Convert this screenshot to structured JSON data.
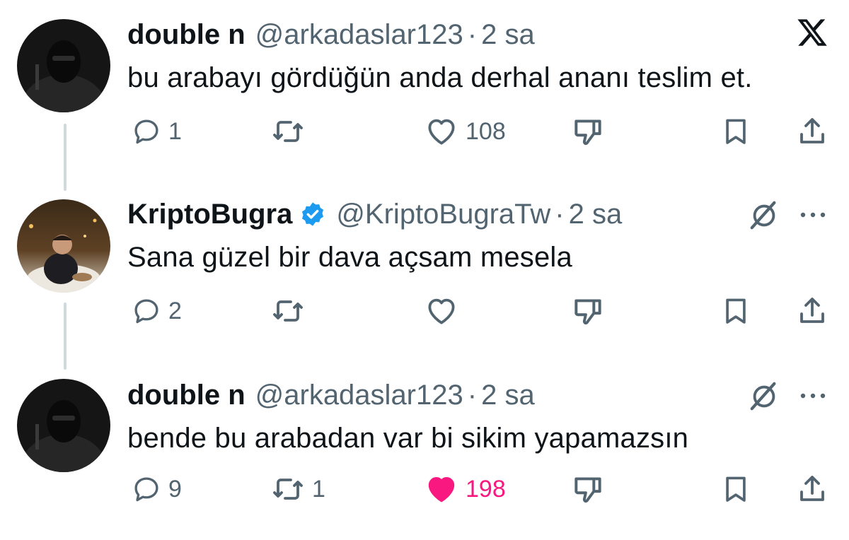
{
  "tweets": [
    {
      "author": "double n",
      "handle": "@arkadaslar123",
      "time": "2 sa",
      "text": "bu arabayı gördüğün anda derhal ananı teslim et.",
      "verified": false,
      "actions": {
        "reply": "1",
        "repost": "",
        "like": "108",
        "liked": false
      },
      "corner_icon": "x-logo-icon"
    },
    {
      "author": "KriptoBugra",
      "handle": "@KriptoBugraTw",
      "time": "2 sa",
      "text": "Sana güzel bir dava açsam mesela",
      "verified": true,
      "actions": {
        "reply": "2",
        "repost": "",
        "like": "",
        "liked": false
      },
      "corner_icon": "grok-icon"
    },
    {
      "author": "double n",
      "handle": "@arkadaslar123",
      "time": "2 sa",
      "text": "bende bu arabadan var bi sikim yapamazsın",
      "verified": false,
      "actions": {
        "reply": "9",
        "repost": "1",
        "like": "198",
        "liked": true
      },
      "corner_icon": "grok-icon"
    }
  ],
  "separator": "·",
  "colors": {
    "text": "#0f1419",
    "secondary": "#536471",
    "like_active": "#f91880",
    "verified": "#1d9bf0",
    "thread_line": "#cfd9de"
  },
  "icons": [
    "reply-icon",
    "repost-icon",
    "heart-icon",
    "dislike-icon",
    "bookmark-icon",
    "share-icon",
    "more-icon",
    "x-logo-icon",
    "grok-icon",
    "verified-badge-icon"
  ]
}
